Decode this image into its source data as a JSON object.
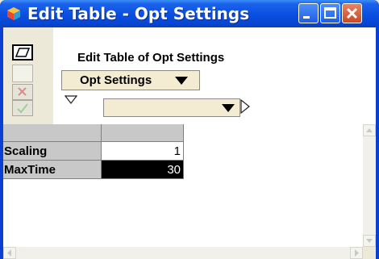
{
  "window": {
    "title": "Edit Table - Opt Settings",
    "controls": [
      "minimize-icon",
      "maximize-icon",
      "close-icon"
    ]
  },
  "toolbar": {
    "heading": "Edit Table of Opt Settings",
    "table_selector": "Opt Settings",
    "index_selector": ""
  },
  "side_buttons": [
    "edit-icon",
    "cancel-icon",
    "accept-icon"
  ],
  "table": {
    "column_header": "",
    "rows": [
      {
        "label": "Scaling",
        "value": "1",
        "selected": false
      },
      {
        "label": "MaxTime",
        "value": "30",
        "selected": true
      }
    ]
  },
  "colors": {
    "titlebar": "#0a4ee0",
    "dropdown_fill": "#f4ecd2",
    "header_gray": "#c8c8c8",
    "selected_cell": "#000000"
  }
}
